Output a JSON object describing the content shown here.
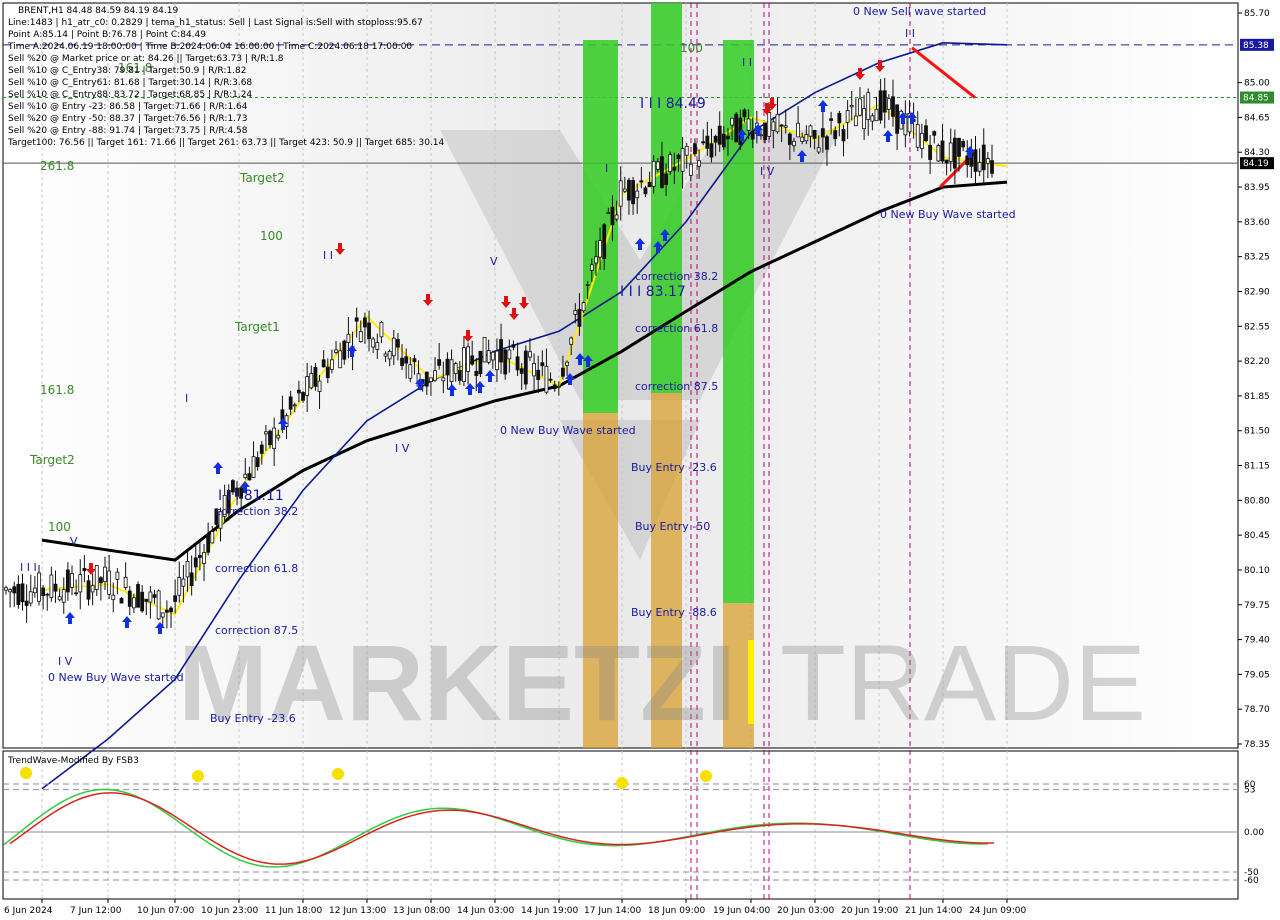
{
  "header": {
    "symbol_line": "BRENT,H1  84.48 84.59 84.19 84.19",
    "lines": [
      "Line:1483 | h1_atr_c0: 0.2829 | tema_h1_status: Sell | Last Signal is:Sell with stoploss:95.67",
      "Point A:85.14 | Point B:76.78 | Point C:84.49",
      "Time A:2024.06.19 18:00:00 | Time B:2024.06.04 16:00:00 | Time C:2024.06.18 17:00:00",
      "Sell %20 @ Market price or at: 84.26 || Target:63.73 | R/R:1.8",
      "Sell %10 @ C_Entry38: 79.81 | Target:50.9 | R/R:1.82",
      "Sell %10 @ C_Entry61: 81.68 | Target:30.14 | R/R:3.68",
      "Sell %10 @ C_Entry88: 83.72 | Target:68.85 | R/R:1.24",
      "Sell %10 @ Entry -23: 86.58 | Target:71.66 | R/R:1.64",
      "Sell %20 @ Entry -50: 88.37 | Target:76.56 | R/R:1.73",
      "Sell %20 @ Entry -88: 91.74 | Target:73.75 | R/R:4.58",
      "Target100: 76.56 || Target 161: 71.66 || Target 261: 63.73 || Target 423: 50.9 || Target 685: 30.14"
    ]
  },
  "watermark": {
    "left": "MARKETZI",
    "right": "TRADE"
  },
  "price_axis": {
    "ticks": [
      "85.70",
      "85.00",
      "84.65",
      "84.30",
      "83.95",
      "83.60",
      "83.25",
      "82.90",
      "82.55",
      "82.20",
      "81.85",
      "81.50",
      "81.15",
      "80.80",
      "80.45",
      "80.10",
      "79.75",
      "79.40",
      "79.05",
      "78.70",
      "78.35"
    ],
    "tags": [
      {
        "label": "85.38",
        "color": "#1a1aa0"
      },
      {
        "label": "84.85",
        "color": "#2e8b2e"
      },
      {
        "label": "84.19",
        "color": "#000000"
      }
    ]
  },
  "time_axis": {
    "labels": [
      "6 Jun 2024",
      "7 Jun 12:00",
      "10 Jun 07:00",
      "10 Jun 23:00",
      "11 Jun 18:00",
      "12 Jun 13:00",
      "13 Jun 08:00",
      "14 Jun 03:00",
      "14 Jun 19:00",
      "17 Jun 14:00",
      "18 Jun 09:00",
      "19 Jun 04:00",
      "20 Jun 03:00",
      "20 Jun 19:00",
      "21 Jun 14:00",
      "24 Jun 09:00"
    ]
  },
  "annotations": {
    "left_levels": [
      {
        "text": "261.8"
      },
      {
        "text": "Target2"
      },
      {
        "text": "100"
      },
      {
        "text": "Target1"
      },
      {
        "text": "161.8"
      },
      {
        "text": "Target2"
      },
      {
        "text": "100"
      },
      {
        "text": "161.8"
      },
      {
        "text": "100"
      }
    ],
    "blue_texts": [
      {
        "text": "0 New Sell wave started"
      },
      {
        "text": "0 New Buy Wave started"
      },
      {
        "text": "0 New Buy Wave started"
      },
      {
        "text": "0 New Buy Wave started"
      },
      {
        "text": "correction 38.2"
      },
      {
        "text": "correction 61.8"
      },
      {
        "text": "correction 87.5"
      },
      {
        "text": "Buy Entry -23.6"
      },
      {
        "text": "correction 38.2"
      },
      {
        "text": "correction 61.8"
      },
      {
        "text": "correction 87.5"
      },
      {
        "text": "Buy Entry -23.6"
      },
      {
        "text": "Buy Entry -50"
      },
      {
        "text": "Buy Entry -88.6"
      },
      {
        "text": "I I I 81.11"
      },
      {
        "text": "I I I 83.17"
      },
      {
        "text": "I I I 84.49"
      },
      {
        "text": "I I I"
      },
      {
        "text": "I V"
      },
      {
        "text": "I V"
      },
      {
        "text": "V"
      },
      {
        "text": "V"
      },
      {
        "text": "I I"
      },
      {
        "text": "I I"
      },
      {
        "text": "I I"
      },
      {
        "text": "I V"
      },
      {
        "text": "I"
      },
      {
        "text": "I"
      }
    ]
  },
  "indicator": {
    "title": "TrendWave-Modified By FSB3",
    "axis_labels": [
      "60",
      "53",
      "0.00",
      "-50",
      "-60"
    ],
    "colors": {
      "fast": "#2ecc40",
      "slow": "#e02020",
      "dot": "#f5e000"
    }
  },
  "chart_data": {
    "type": "line",
    "title": "BRENT,H1",
    "xlabel": "",
    "ylabel": "",
    "ylim": [
      78.35,
      85.7
    ],
    "x": [
      "6 Jun 2024",
      "7 Jun 12:00",
      "10 Jun 07:00",
      "10 Jun 23:00",
      "11 Jun 18:00",
      "12 Jun 13:00",
      "13 Jun 08:00",
      "14 Jun 03:00",
      "14 Jun 19:00",
      "17 Jun 14:00",
      "18 Jun 09:00",
      "19 Jun 04:00",
      "20 Jun 03:00",
      "20 Jun 19:00",
      "21 Jun 14:00",
      "24 Jun 09:00"
    ],
    "series": [
      {
        "values": [
          79.9,
          80.0,
          79.7,
          80.9,
          81.8,
          82.6,
          82.0,
          82.3,
          82.0,
          83.9,
          84.2,
          84.6,
          84.4,
          84.8,
          84.3,
          84.19
        ]
      },
      {
        "values": [
          80.4,
          80.3,
          80.2,
          80.7,
          81.1,
          81.4,
          81.6,
          81.8,
          81.95,
          82.3,
          82.7,
          83.1,
          83.4,
          83.7,
          83.95,
          84.0
        ]
      },
      {
        "values": [
          77.9,
          78.4,
          79.0,
          80.0,
          80.9,
          81.6,
          82.0,
          82.3,
          82.5,
          82.9,
          83.6,
          84.5,
          84.9,
          85.2,
          85.4,
          85.38
        ]
      }
    ],
    "levels": [
      85.38,
      84.85,
      84.19
    ],
    "colors": {
      "price": "#1a1a1a",
      "ema200": "#000000",
      "ema_blue": "#0b1a8c",
      "tema": "#ffee00"
    },
    "grid": true
  }
}
